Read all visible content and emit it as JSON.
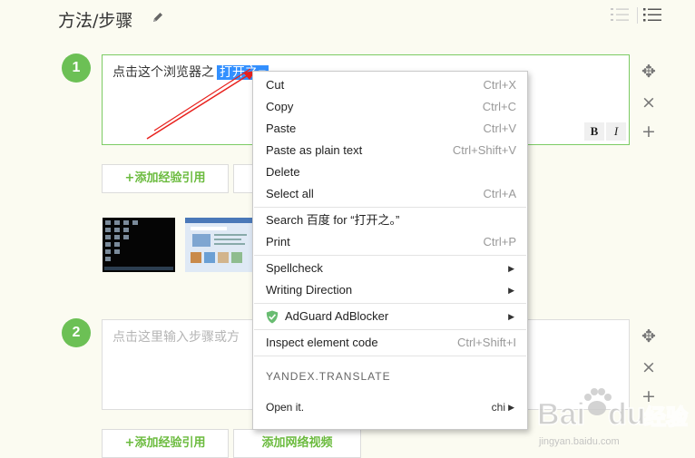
{
  "header": {
    "title": "方法/步骤"
  },
  "steps": [
    {
      "number": "1",
      "text": "点击这个浏览器之",
      "selected_text": "打开之",
      "caret": "▼"
    },
    {
      "number": "2",
      "placeholder": "点击这里输入步骤或方"
    }
  ],
  "format_buttons": {
    "bold": "B",
    "italic": "I"
  },
  "side_tools": {
    "move": "✥",
    "delete": "×",
    "add": "+"
  },
  "actions": {
    "add_reference": "+添加经验引用",
    "add_video": "添加网络视频"
  },
  "context_menu": {
    "items": [
      {
        "label": "Cut",
        "shortcut": "Ctrl+X"
      },
      {
        "label": "Copy",
        "shortcut": "Ctrl+C"
      },
      {
        "label": "Paste",
        "shortcut": "Ctrl+V"
      },
      {
        "label": "Paste as plain text",
        "shortcut": "Ctrl+Shift+V"
      },
      {
        "label": "Delete",
        "shortcut": ""
      },
      {
        "label": "Select all",
        "shortcut": "Ctrl+A"
      },
      {
        "label": "Search 百度 for “打开之。”",
        "shortcut": ""
      },
      {
        "label": "Print",
        "shortcut": "Ctrl+P"
      },
      {
        "label": "Spellcheck",
        "arrow": "▶"
      },
      {
        "label": "Writing Direction",
        "arrow": "▶"
      },
      {
        "label": "AdGuard AdBlocker",
        "arrow": "▶",
        "icon": "shield-check-icon"
      },
      {
        "label": "Inspect element code",
        "shortcut": "Ctrl+Shift+I"
      }
    ],
    "translate": {
      "header": "YANDEX.TRANSLATE",
      "open_label": "Open it.",
      "language": "chi",
      "arrow": "▶"
    }
  },
  "colors": {
    "accent_green": "#6cc055",
    "selection_blue": "#3390ff",
    "annotation_red": "#e8201c"
  },
  "watermark": {
    "brand": "Bai",
    "brand2": "du",
    "cn": "经验",
    "url": "jingyan.baidu.com"
  }
}
